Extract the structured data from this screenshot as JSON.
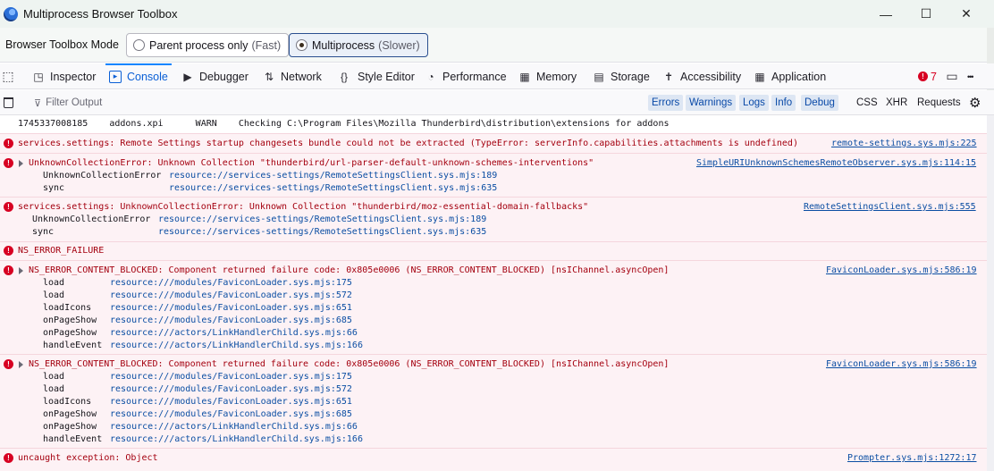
{
  "window": {
    "title": "Multiprocess Browser Toolbox",
    "minimize_glyph": "—",
    "maximize_glyph": "☐",
    "close_glyph": "✕"
  },
  "mode": {
    "label": "Browser Toolbox Mode",
    "options": [
      {
        "label": "Parent process only",
        "hint": "(Fast)"
      },
      {
        "label": "Multiprocess",
        "hint": "(Slower)"
      }
    ]
  },
  "tabs": [
    {
      "label": "Inspector",
      "icon": "inspector-icon",
      "glyph": "◳"
    },
    {
      "label": "Console",
      "icon": "console-icon",
      "glyph": "▸"
    },
    {
      "label": "Debugger",
      "icon": "debugger-icon",
      "glyph": "▶"
    },
    {
      "label": "Network",
      "icon": "network-icon",
      "glyph": "⇅"
    },
    {
      "label": "Style Editor",
      "icon": "style-editor-icon",
      "glyph": "{}"
    },
    {
      "label": "Performance",
      "icon": "performance-icon",
      "glyph": "◔"
    },
    {
      "label": "Memory",
      "icon": "memory-icon",
      "glyph": "▦"
    },
    {
      "label": "Storage",
      "icon": "storage-icon",
      "glyph": "▤"
    },
    {
      "label": "Accessibility",
      "icon": "accessibility-icon",
      "glyph": "✝"
    },
    {
      "label": "Application",
      "icon": "application-icon",
      "glyph": "▦"
    }
  ],
  "toolbar_right": {
    "error_count": "7",
    "error_glyph": "!",
    "layout_glyph": "▭",
    "more_glyph": "•••"
  },
  "filter": {
    "placeholder": "Filter Output",
    "trash_glyph": "🗑",
    "filter_glyph": "⊽",
    "levels": [
      "Errors",
      "Warnings",
      "Logs",
      "Info",
      "Debug"
    ],
    "types": [
      "CSS",
      "XHR",
      "Requests"
    ],
    "settings_glyph": "⚙"
  },
  "colors": {
    "accent": "#0a84ff",
    "error_text": "#a4000f",
    "error_bg": "#fdf2f5",
    "link": "#0b4ea3"
  },
  "messages": [
    {
      "kind": "plain",
      "text": "1745337008185    addons.xpi      WARN    Checking C:\\Program Files\\Mozilla Thunderbird\\distribution\\extensions for addons",
      "source": "",
      "frames": []
    },
    {
      "kind": "error",
      "expandable": false,
      "text": "services.settings: Remote Settings startup changesets bundle could not be extracted (TypeError: serverInfo.capabilities.attachments is undefined)",
      "source": "remote-settings.sys.mjs:225",
      "frames": []
    },
    {
      "kind": "error",
      "expandable": true,
      "text": "UnknownCollectionError: Unknown Collection \"thunderbird/url-parser-default-unknown-schemes-interventions\"",
      "source": "SimpleURIUnknownSchemesRemoteObserver.sys.mjs:114:15",
      "frames": [
        {
          "fn": "UnknownCollectionError",
          "loc": "resource://services-settings/RemoteSettingsClient.sys.mjs:189"
        },
        {
          "fn": "sync",
          "loc": "resource://services-settings/RemoteSettingsClient.sys.mjs:635"
        }
      ]
    },
    {
      "kind": "error",
      "expandable": false,
      "text": "services.settings: UnknownCollectionError: Unknown Collection \"thunderbird/moz-essential-domain-fallbacks\"",
      "source": "RemoteSettingsClient.sys.mjs:555",
      "frames": [
        {
          "fn": "UnknownCollectionError",
          "loc": "resource://services-settings/RemoteSettingsClient.sys.mjs:189"
        },
        {
          "fn": "sync",
          "loc": "resource://services-settings/RemoteSettingsClient.sys.mjs:635"
        }
      ]
    },
    {
      "kind": "error",
      "expandable": false,
      "text": "NS_ERROR_FAILURE",
      "source": "",
      "frames": []
    },
    {
      "kind": "error",
      "expandable": true,
      "text": "NS_ERROR_CONTENT_BLOCKED: Component returned failure code: 0x805e0006 (NS_ERROR_CONTENT_BLOCKED) [nsIChannel.asyncOpen]",
      "source": "FaviconLoader.sys.mjs:586:19",
      "frames": [
        {
          "fn": "load",
          "loc": "resource:///modules/FaviconLoader.sys.mjs:175"
        },
        {
          "fn": "load",
          "loc": "resource:///modules/FaviconLoader.sys.mjs:572"
        },
        {
          "fn": "loadIcons",
          "loc": "resource:///modules/FaviconLoader.sys.mjs:651"
        },
        {
          "fn": "onPageShow",
          "loc": "resource:///modules/FaviconLoader.sys.mjs:685"
        },
        {
          "fn": "onPageShow",
          "loc": "resource:///actors/LinkHandlerChild.sys.mjs:66"
        },
        {
          "fn": "handleEvent",
          "loc": "resource:///actors/LinkHandlerChild.sys.mjs:166"
        }
      ]
    },
    {
      "kind": "error",
      "expandable": true,
      "text": "NS_ERROR_CONTENT_BLOCKED: Component returned failure code: 0x805e0006 (NS_ERROR_CONTENT_BLOCKED) [nsIChannel.asyncOpen]",
      "source": "FaviconLoader.sys.mjs:586:19",
      "frames": [
        {
          "fn": "load",
          "loc": "resource:///modules/FaviconLoader.sys.mjs:175"
        },
        {
          "fn": "load",
          "loc": "resource:///modules/FaviconLoader.sys.mjs:572"
        },
        {
          "fn": "loadIcons",
          "loc": "resource:///modules/FaviconLoader.sys.mjs:651"
        },
        {
          "fn": "onPageShow",
          "loc": "resource:///modules/FaviconLoader.sys.mjs:685"
        },
        {
          "fn": "onPageShow",
          "loc": "resource:///actors/LinkHandlerChild.sys.mjs:66"
        },
        {
          "fn": "handleEvent",
          "loc": "resource:///actors/LinkHandlerChild.sys.mjs:166"
        }
      ]
    },
    {
      "kind": "error",
      "expandable": false,
      "text": "uncaught exception: Object",
      "source": "Prompter.sys.mjs:1272:17",
      "frames": []
    }
  ]
}
